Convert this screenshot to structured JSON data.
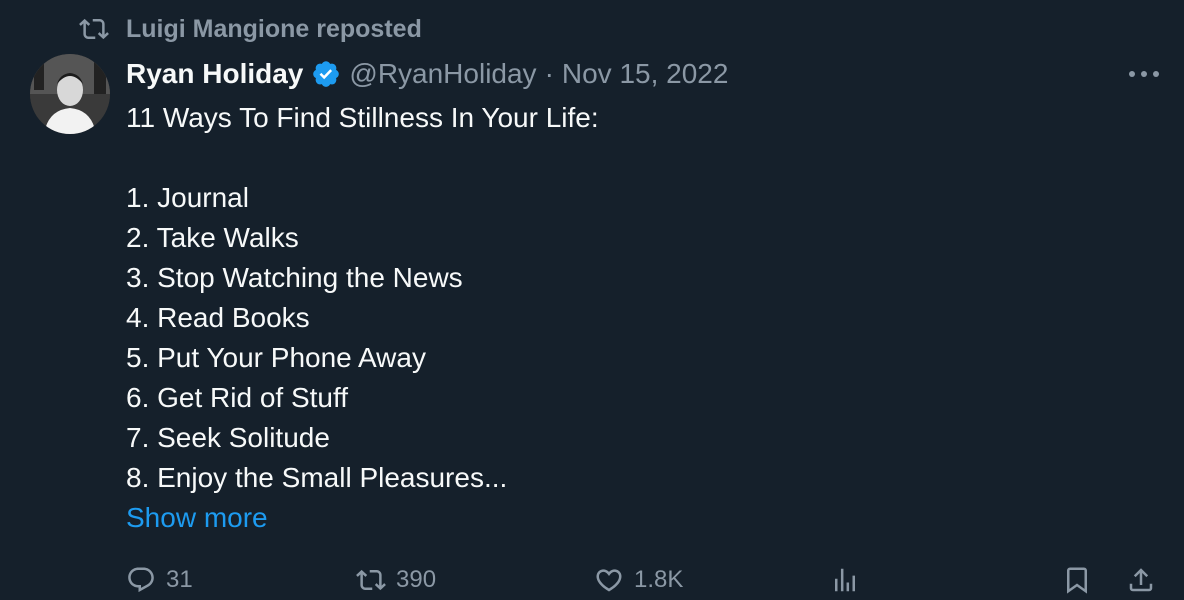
{
  "repost": {
    "label": "Luigi Mangione reposted",
    "icon": "repost-icon"
  },
  "author": {
    "name": "Ryan Holiday",
    "handle": "@RyanHoliday",
    "separator": "·",
    "date": "Nov 15, 2022",
    "verified": true,
    "verified_color": "#1d9bf0"
  },
  "post": {
    "lines": [
      "11 Ways To Find Stillness In Your Life:",
      "",
      "1. Journal",
      "2. Take Walks",
      "3. Stop Watching the News",
      "4. Read Books",
      "5. Put Your Phone Away",
      "6. Get Rid of Stuff",
      "7. Seek Solitude",
      "8. Enjoy the Small Pleasures..."
    ],
    "show_more": "Show more"
  },
  "actions": {
    "replies": "31",
    "reposts": "390",
    "likes": "1.8K"
  },
  "colors": {
    "background": "#15202b",
    "text": "#f7f9f9",
    "muted": "#8b98a5",
    "accent": "#1d9bf0"
  }
}
